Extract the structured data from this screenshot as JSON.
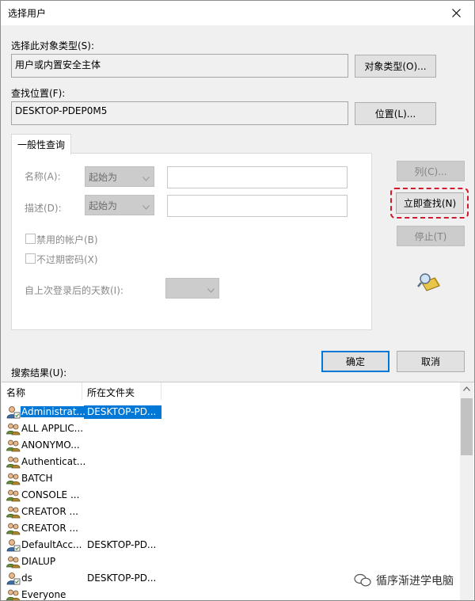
{
  "window": {
    "title": "选择用户"
  },
  "object_type": {
    "label": "选择此对象类型(S):",
    "value": "用户或内置安全主体",
    "button": "对象类型(O)..."
  },
  "location": {
    "label": "查找位置(F):",
    "value": "DESKTOP-PDEP0M5",
    "button": "位置(L)..."
  },
  "query": {
    "tab": "一般性查询",
    "name_label": "名称(A):",
    "name_mode": "起始为",
    "desc_label": "描述(D):",
    "desc_mode": "起始为",
    "disabled_accounts": "禁用的帐户(B)",
    "no_expire_pwd": "不过期密码(X)",
    "days_label": "自上次登录后的天数(I):"
  },
  "buttons": {
    "columns": "列(C)...",
    "find_now": "立即查找(N)",
    "stop": "停止(T)",
    "ok": "确定",
    "cancel": "取消"
  },
  "results": {
    "label": "搜索结果(U):",
    "col_name": "名称",
    "col_folder": "所在文件夹",
    "rows": [
      {
        "name": "Administrat...",
        "folder": "DESKTOP-PD...",
        "icon": "user-icon"
      },
      {
        "name": "ALL APPLIC...",
        "folder": "",
        "icon": "group-icon"
      },
      {
        "name": "ANONYMO...",
        "folder": "",
        "icon": "group-icon"
      },
      {
        "name": "Authenticat...",
        "folder": "",
        "icon": "group-icon"
      },
      {
        "name": "BATCH",
        "folder": "",
        "icon": "group-icon"
      },
      {
        "name": "CONSOLE ...",
        "folder": "",
        "icon": "group-icon"
      },
      {
        "name": "CREATOR ...",
        "folder": "",
        "icon": "group-icon"
      },
      {
        "name": "CREATOR ...",
        "folder": "",
        "icon": "group-icon"
      },
      {
        "name": "DefaultAcc...",
        "folder": "DESKTOP-PD...",
        "icon": "user-icon"
      },
      {
        "name": "DIALUP",
        "folder": "",
        "icon": "group-icon"
      },
      {
        "name": "ds",
        "folder": "DESKTOP-PD...",
        "icon": "user-icon"
      },
      {
        "name": "Everyone",
        "folder": "",
        "icon": "group-icon"
      }
    ]
  },
  "watermark": {
    "text": "循序渐进学电脑"
  },
  "colors": {
    "accent": "#0078d7",
    "highlight": "#d1182f"
  }
}
